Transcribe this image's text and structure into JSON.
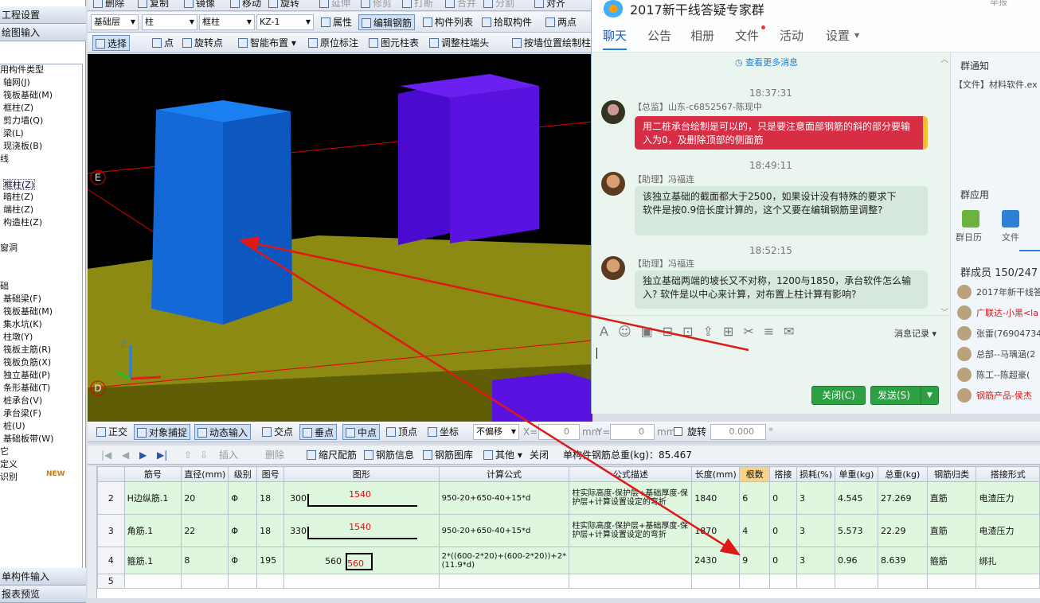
{
  "left": {
    "header1": "工程设置",
    "header2": "绘图输入",
    "header3": "单构件输入",
    "header4": "报表预览",
    "tree": [
      "用构件类型",
      "轴网(J)",
      "筏板基础(M)",
      "框柱(Z)",
      "剪力墙(Q)",
      "梁(L)",
      "现浇板(B)",
      "线",
      "框柱(Z)",
      "暗柱(Z)",
      "端柱(Z)",
      "构造柱(Z)",
      "窗洞",
      "础",
      "基础梁(F)",
      "筏板基础(M)",
      "集水坑(K)",
      "柱墩(Y)",
      "筏板主筋(R)",
      "筏板负筋(X)",
      "独立基础(P)",
      "条形基础(T)",
      "桩承台(V)",
      "承台梁(F)",
      "桩(U)",
      "基础板带(W)",
      "它",
      "定义",
      "识别"
    ],
    "new_badge": "NEW"
  },
  "toolbar1": {
    "items": [
      "删除",
      "复制",
      "镜像",
      "移动",
      "旋转",
      "延伸",
      "修剪",
      "打断",
      "合并",
      "分割",
      "对齐"
    ]
  },
  "toolbar2": {
    "layer": "基础层",
    "type": "柱",
    "subtype": "框柱",
    "name": "KZ-1",
    "items": [
      "属性",
      "编辑钢筋",
      "构件列表",
      "拾取构件",
      "两点"
    ]
  },
  "toolbar3": {
    "items": [
      "选择",
      "点",
      "旋转点",
      "智能布置",
      "原位标注",
      "图元柱表",
      "调整柱端头",
      "按墙位置绘制柱"
    ]
  },
  "view": {
    "axis_e": "E",
    "axis_d": "D",
    "axis_z": "Z"
  },
  "snapbar": {
    "items": [
      "正交",
      "对象捕捉",
      "动态输入",
      "交点",
      "垂点",
      "中点",
      "顶点",
      "坐标"
    ],
    "offset": "不偏移",
    "x_label": "X=",
    "x_val": "0",
    "y_label": "Y=",
    "y_val": "0",
    "unit": "mm",
    "rotate": "旋转",
    "rotate_val": "0.000",
    "deg": "°"
  },
  "rebarbar": {
    "items": [
      "插入",
      "删除",
      "缩尺配筋",
      "钢筋信息",
      "钢筋图库",
      "其他",
      "关闭"
    ],
    "total_label": "单构件钢筋总重(kg)：",
    "total_value": "85.467"
  },
  "table": {
    "headers": [
      "",
      "筋号",
      "直径(mm)",
      "级别",
      "图号",
      "图形",
      "计算公式",
      "公式描述",
      "长度(mm)",
      "根数",
      "搭接",
      "损耗(%)",
      "单重(kg)",
      "总重(kg)",
      "钢筋归类",
      "搭接形式"
    ],
    "rows": [
      {
        "no": "2",
        "name": "H边纵筋.1",
        "dia": "20",
        "grade": "Φ",
        "fig": "18",
        "shape_a": "300",
        "shape_b": "1540",
        "formula": "950-20+650-40+15*d",
        "desc": "柱实际高度-保护层+基础厚度-保护层+计算设置设定的弯折",
        "len": "1840",
        "count": "6",
        "lap": "0",
        "loss": "3",
        "unit": "4.545",
        "total": "27.269",
        "cat": "直筋",
        "lapform": "电渣压力"
      },
      {
        "no": "3",
        "name": "角筋.1",
        "dia": "22",
        "grade": "Φ",
        "fig": "18",
        "shape_a": "330",
        "shape_b": "1540",
        "formula": "950-20+650-40+15*d",
        "desc": "柱实际高度-保护层+基础厚度-保护层+计算设置设定的弯折",
        "len": "1870",
        "count": "4",
        "lap": "0",
        "loss": "3",
        "unit": "5.573",
        "total": "22.29",
        "cat": "直筋",
        "lapform": "电渣压力"
      },
      {
        "no": "4",
        "name": "箍筋.1",
        "dia": "8",
        "grade": "Φ",
        "fig": "195",
        "shape_a": "560",
        "shape_b": "560",
        "formula": "2*((600-2*20)+(600-2*20))+2*(11.9*d)",
        "desc": "",
        "len": "2430",
        "count": "9",
        "lap": "0",
        "loss": "3",
        "unit": "0.96",
        "total": "8.639",
        "cat": "箍筋",
        "lapform": "绑扎"
      },
      {
        "no": "5",
        "name": "",
        "dia": "",
        "grade": "",
        "fig": "",
        "shape_a": "",
        "shape_b": "",
        "formula": "",
        "desc": "",
        "len": "",
        "count": "",
        "lap": "",
        "loss": "",
        "unit": "",
        "total": "",
        "cat": "",
        "lapform": ""
      }
    ]
  },
  "chat": {
    "title": "2017新干线答疑专家群",
    "top_right": "举报",
    "tabs": [
      "聊天",
      "公告",
      "相册",
      "文件",
      "活动",
      "设置"
    ],
    "more": "查看更多消息",
    "messages": [
      {
        "time": "18:37:31",
        "sender": "【总监】山东-c6852567-陈现中",
        "text": "用二桩承台绘制是可以的，只是要注意面部钢筋的斜的部分要输入为0，及删除顶部的侧面筋"
      },
      {
        "time": "18:49:11",
        "sender": "【助理】冯福连",
        "text": "该独立基础的截面都大于2500，如果设计没有特殊的要求下\n软件是按0.9倍长度计算的，这个又要在编辑钢筋里调整?"
      },
      {
        "time": "18:52:15",
        "sender": "【助理】冯福连",
        "text": "独立基础两端的坡长又不对称，1200与1850，承台软件怎么输入? 软件是以中心来计算，对布置上柱计算有影响?"
      }
    ],
    "msg_record": "消息记录",
    "close_btn": "关闭(C)",
    "send_btn": "发送(S)",
    "notice_title": "群通知",
    "notice_text": "【文件】材料软件.ex",
    "apps_title": "群应用",
    "apps": [
      "群日历",
      "文件"
    ],
    "members_title": "群成员 150/247",
    "members": [
      "2017年新干线答",
      "广联达-小黑<la",
      "张雷(769047347",
      "总部--马瑀涵(2",
      "陈工--陈超豪(",
      "钢筋产品-侯杰"
    ]
  }
}
